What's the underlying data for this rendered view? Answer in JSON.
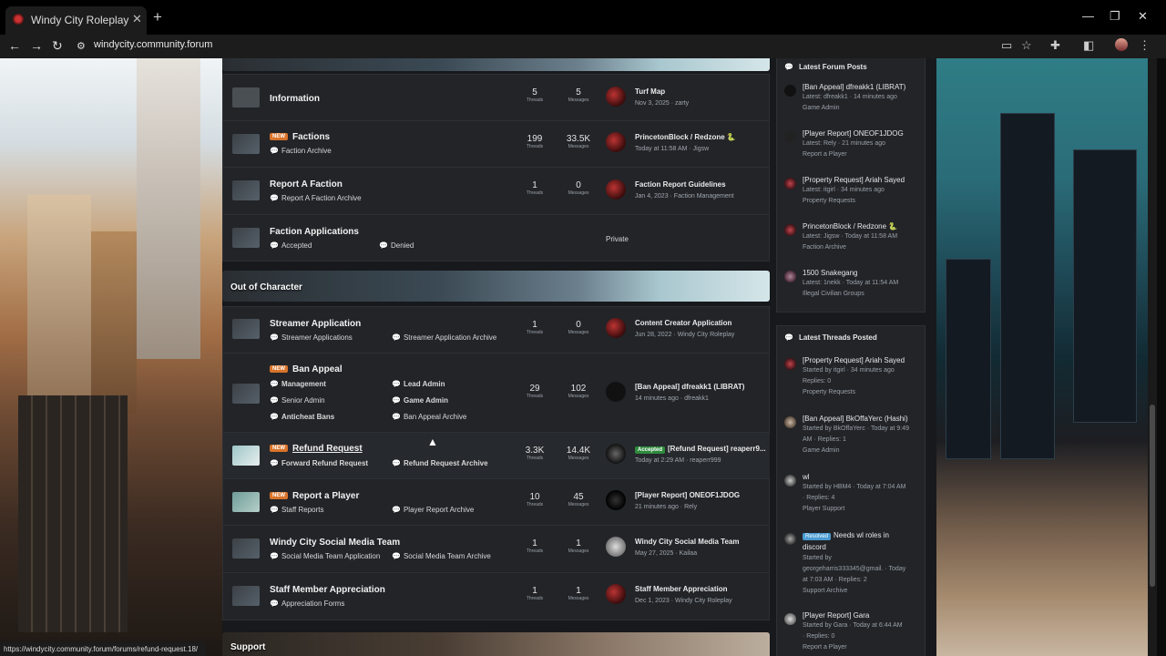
{
  "browser": {
    "tab_title": "Windy City Roleplay",
    "url": "windycity.community.forum",
    "status_url": "https://windycity.community.forum/forums/refund-request.18/"
  },
  "sections": {
    "ooc_title": "Out of Character",
    "support_title": "Support"
  },
  "labels": {
    "threads": "Threads",
    "messages": "Messages",
    "new": "NEW",
    "private": "Private",
    "accepted": "Accepted",
    "resolved": "Resolved"
  },
  "nodes_top": [
    {
      "title": "Information",
      "threads": "5",
      "messages": "5",
      "last_title": "Turf Map",
      "last_meta": "Nov 3, 2025 · zarty"
    },
    {
      "title": "Factions",
      "sub1": "Faction Archive",
      "threads": "199",
      "messages": "33.5K",
      "last_title": "PrincetonBlock / Redzone 🐍",
      "last_meta": "Today at 11:58 AM · Jigsw"
    },
    {
      "title": "Report A Faction",
      "sub1": "Report A Faction Archive",
      "threads": "1",
      "messages": "0",
      "last_title": "Faction Report Guidelines",
      "last_meta": "Jan 4, 2023 · Faction Management"
    },
    {
      "title": "Faction Applications",
      "sub1": "Accepted",
      "sub2": "Denied"
    }
  ],
  "nodes_ooc": [
    {
      "title": "Streamer Application",
      "sub1": "Streamer Applications",
      "sub2": "Streamer Application Archive",
      "threads": "1",
      "messages": "0",
      "last_title": "Content Creator Application",
      "last_meta": "Jun 28, 2022 · Windy City Roleplay"
    },
    {
      "title": "Ban Appeal",
      "sub1": "Management",
      "sub2": "Lead Admin",
      "sub3": "Senior Admin",
      "sub4": "Game Admin",
      "sub5": "Anticheat Bans",
      "sub6": "Ban Appeal Archive",
      "threads": "29",
      "messages": "102",
      "last_title": "[Ban Appeal] dfreakk1 (LIBRAT)",
      "last_meta": "14 minutes ago · dfreakk1"
    },
    {
      "title": "Refund Request",
      "sub1": "Forward Refund Request",
      "sub2": "Refund Request Archive",
      "threads": "3.3K",
      "messages": "14.4K",
      "last_title": "[Refund Request] reaperr9...",
      "last_meta": "Today at 2:29 AM · reaperr999"
    },
    {
      "title": "Report a Player",
      "sub1": "Staff Reports",
      "sub2": "Player Report Archive",
      "threads": "10",
      "messages": "45",
      "last_title": "[Player Report] ONEOF1JDOG",
      "last_meta": "21 minutes ago · Rely"
    },
    {
      "title": "Windy City Social Media Team",
      "sub1": "Social Media Team Application",
      "sub2": "Social Media Team Archive",
      "threads": "1",
      "messages": "1",
      "last_title": "Windy City Social Media Team",
      "last_meta": "May 27, 2025 · Kailaa"
    },
    {
      "title": "Staff Member Appreciation",
      "sub1": "Appreciation Forms",
      "threads": "1",
      "messages": "1",
      "last_title": "Staff Member Appreciation",
      "last_meta": "Dec 1, 2023 · Windy City Roleplay"
    }
  ],
  "latest_posts": {
    "heading": "Latest Forum Posts",
    "items": [
      {
        "title": "[Ban Appeal] dfreakk1 (LIBRAT)",
        "meta1": "Latest: dfreakk1 · 14 minutes ago",
        "meta2": "Game Admin"
      },
      {
        "title": "[Player Report] ONEOF1JDOG",
        "meta1": "Latest: Rely · 21 minutes ago",
        "meta2": "Report a Player"
      },
      {
        "title": "[Property Request] Ariah Sayed",
        "meta1": "Latest: itgirl · 34 minutes ago",
        "meta2": "Property Requests"
      },
      {
        "title": "PrincetonBlock / Redzone 🐍",
        "meta1": "Latest: Jigsw · Today at 11:58 AM",
        "meta2": "Faction Archive"
      },
      {
        "title": "1500 Snakegang",
        "meta1": "Latest: 1nekk · Today at 11:54 AM",
        "meta2": "Illegal Civilian Groups"
      }
    ]
  },
  "latest_threads": {
    "heading": "Latest Threads Posted",
    "items": [
      {
        "title": "[Property Request] Ariah Sayed",
        "meta1": "Started by itgirl · 34 minutes ago",
        "meta2": "Replies: 0",
        "meta3": "Property Requests"
      },
      {
        "title": "[Ban Appeal] BkOffaYerc (Hashi)",
        "meta1": "Started by BkOffaYerc · Today at 9:49",
        "meta2": "AM · Replies: 1",
        "meta3": "Game Admin"
      },
      {
        "title": "wl",
        "meta1": "Started by HBM4 · Today at 7:04 AM",
        "meta2": "· Replies: 4",
        "meta3": "Player Support"
      },
      {
        "title": "Needs wl roles in",
        "title2": "discord",
        "meta1": "Started by",
        "meta2": "georgeharris333345@gmail. · Today",
        "meta3": "at 7:03 AM · Replies: 2",
        "meta4": "Support Archive"
      },
      {
        "title": "[Player Report] Gara",
        "meta1": "Started by Gara · Today at 6:44 AM",
        "meta2": "· Replies: 0",
        "meta3": "Report a Player"
      }
    ]
  }
}
